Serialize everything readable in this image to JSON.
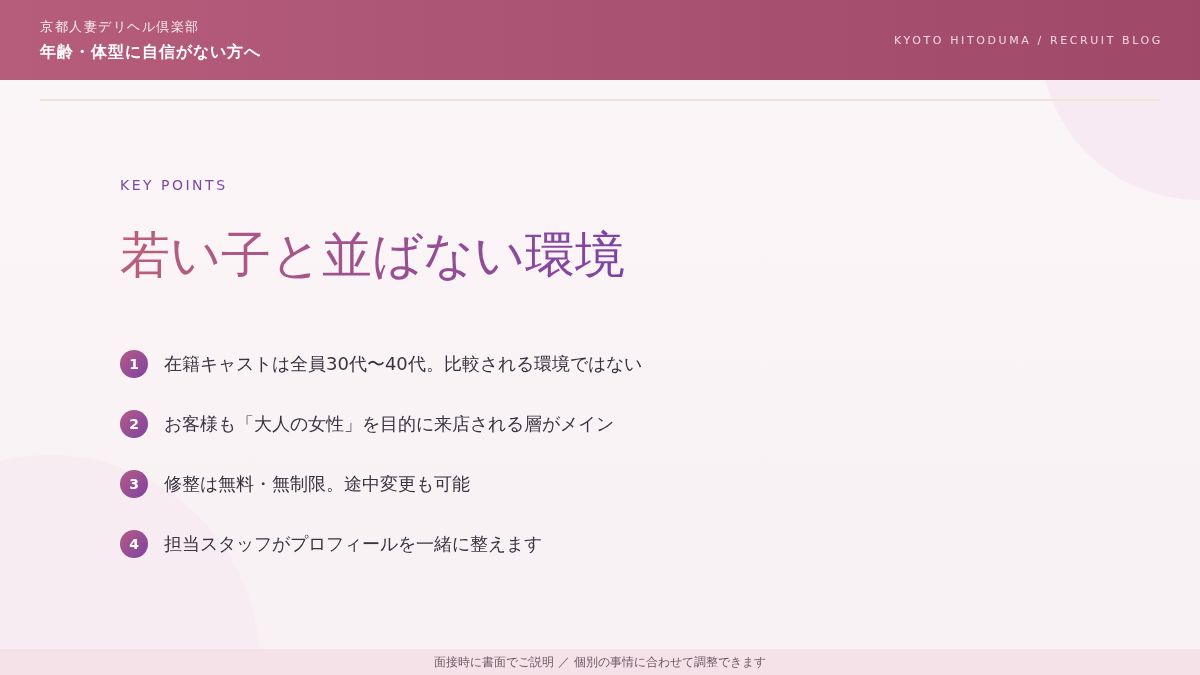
{
  "header": {
    "brand": "京都人妻デリヘル倶楽部",
    "subtitle": "年齢・体型に自信がない方へ",
    "tagline": "KYOTO HITODUMA / RECRUIT BLOG"
  },
  "section": {
    "eyebrow": "KEY POINTS",
    "title": "若い子と並ばない環境"
  },
  "points": [
    {
      "number": "1",
      "text": "在籍キャストは全員30代〜40代。比較される環境ではない"
    },
    {
      "number": "2",
      "text": "お客様も「大人の女性」を目的に来店される層がメイン"
    },
    {
      "number": "3",
      "text": "修整は無料・無制限。途中変更も可能"
    },
    {
      "number": "4",
      "text": "担当スタッフがプロフィールを一緒に整えます"
    }
  ],
  "footer": {
    "note": "面接時に書面でご説明 ／ 個別の事情に合わせて調整できます"
  }
}
